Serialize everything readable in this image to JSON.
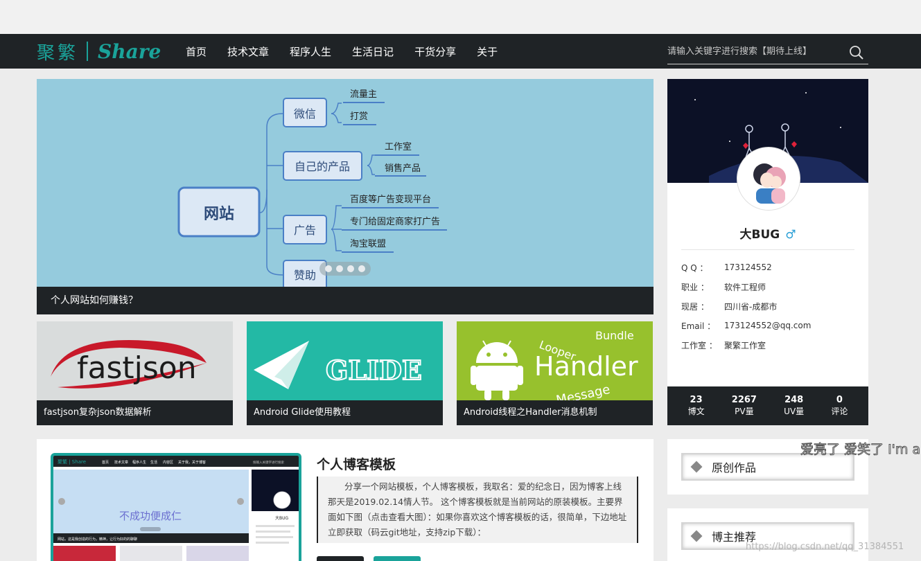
{
  "header": {
    "logo_cn": "聚繁",
    "logo_en": "Share",
    "nav": [
      {
        "label": "首页"
      },
      {
        "label": "技术文章"
      },
      {
        "label": "程序人生"
      },
      {
        "label": "生活日记"
      },
      {
        "label": "干货分享"
      },
      {
        "label": "关于"
      }
    ],
    "search_placeholder": "请输入关键字进行搜索【期待上线】",
    "search_icon": "search-icon"
  },
  "slider": {
    "caption": "个人网站如何赚钱？",
    "mindmap": {
      "root": "网站",
      "branches": [
        {
          "label": "微信",
          "leaves": [
            "流量主",
            "打赏"
          ]
        },
        {
          "label": "自己的产品",
          "leaves": [
            "工作室",
            "销售产品"
          ]
        },
        {
          "label": "广告",
          "leaves": [
            "百度等广告变现平台",
            "专门给固定商家打广告",
            "淘宝联盟"
          ]
        },
        {
          "label": "赞助",
          "leaves": []
        }
      ]
    },
    "dots": 4
  },
  "cards": [
    {
      "title": "fastjson复杂json数据解析",
      "image_text": "fastjson"
    },
    {
      "title": "Android Glide使用教程",
      "image_text": "GLIDE"
    },
    {
      "title": "Android线程之Handler消息机制",
      "image_text": "Handler",
      "image_sub_1": "Looper",
      "image_sub_2": "Bundle",
      "image_sub_3": "Message"
    }
  ],
  "profile": {
    "name": "大BUG",
    "gender_symbol": "♂",
    "info": [
      {
        "key": "Q Q ：",
        "value": "173124552"
      },
      {
        "key": "职业 ：",
        "value": "软件工程师"
      },
      {
        "key": "现居 ：",
        "value": "四川省-成都市"
      },
      {
        "key": "Email ：",
        "value": "173124552@qq.com"
      },
      {
        "key": "工作室 ：",
        "value": "聚繁工作室"
      }
    ],
    "stats": [
      {
        "num": "23",
        "label": "博文"
      },
      {
        "num": "2267",
        "label": "PV量"
      },
      {
        "num": "248",
        "label": "UV量"
      },
      {
        "num": "0",
        "label": "评论"
      }
    ]
  },
  "post": {
    "title": "个人博客模板",
    "body": "分享一个网站模板，个人博客模板，我取名：爱的纪念日，因为博客上线那天是2019.02.14情人节。 这个博客模板就是当前网站的原装模板。主要界面如下图（点击查看大图）：如果你喜欢这个博客模板的话，很简单，下边地址立即获取（码云git地址，支持zip下载）：",
    "thumb": {
      "logo": "聚繁 | Share",
      "nav": [
        "首页",
        "技术文章",
        "程序人生",
        "生活",
        "内容区",
        "关于我，关于博客"
      ],
      "search": "搜输入关键字进行搜索",
      "banner_text": "不成功便成仁",
      "caption": "网站，这是我创造的行为，精神，让行为好的的聊聊",
      "profile_name": "大BUG"
    }
  },
  "sidebar": {
    "original_title": "原创作品",
    "recommend_title": "博主推荐"
  },
  "overlay": {
    "danmaku": "爱亮了 爱笑了 I'm a",
    "watermark": "https://blog.csdn.net/qq_31384551"
  },
  "colors": {
    "nav_bg": "#1f2326",
    "accent": "#1aa39a",
    "slider_bg": "#95cbdd",
    "page_bg": "#ececec"
  }
}
